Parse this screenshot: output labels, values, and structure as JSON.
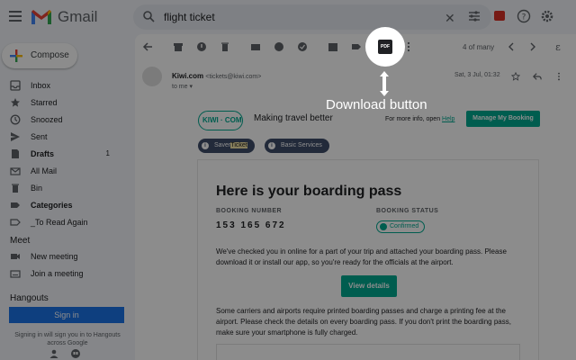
{
  "app": {
    "name": "Gmail"
  },
  "search": {
    "query": "flight ticket"
  },
  "sidebar": {
    "compose_label": "Compose",
    "items": [
      {
        "label": "Inbox",
        "count": ""
      },
      {
        "label": "Starred",
        "count": ""
      },
      {
        "label": "Snoozed",
        "count": ""
      },
      {
        "label": "Sent",
        "count": ""
      },
      {
        "label": "Drafts",
        "count": "1"
      },
      {
        "label": "All Mail",
        "count": ""
      },
      {
        "label": "Bin",
        "count": ""
      },
      {
        "label": "Categories",
        "count": ""
      },
      {
        "label": "_To Read Again",
        "count": ""
      }
    ],
    "meet_header": "Meet",
    "meet_items": [
      "New meeting",
      "Join a meeting"
    ],
    "hangouts_header": "Hangouts",
    "signin_label": "Sign in",
    "signin_text": "Signing in will sign you in to Hangouts across Google"
  },
  "toolbar": {
    "page_count": "4 of many",
    "pdf_label": "PDF"
  },
  "annotation": {
    "callout": "Download button"
  },
  "email": {
    "sender_name": "Kiwi.com",
    "sender_email": "<tickets@kiwi.com>",
    "to": "to me",
    "date": "Sat, 3 Jul, 01:32",
    "logo_text": "KIWI · COM",
    "tagline": "Making travel better",
    "more_info": "For more info, open",
    "help_link": "Help",
    "manage_btn": "Manage My Booking",
    "pill1_pre": "Saver",
    "pill1_hl": "Ticket",
    "pill2": "Basic Services",
    "heading": "Here is your boarding pass",
    "booking_number_label": "BOOKING NUMBER",
    "booking_number": "153 165 672",
    "booking_status_label": "BOOKING STATUS",
    "booking_status": "Confirmed",
    "para1": "We've checked you in online for a part of your trip and attached your boarding pass. Please download it or install our app, so you're ready for the officials at the airport.",
    "view_btn": "View details",
    "para2": "Some carriers and airports require printed boarding passes and charge a printing fee at the airport. Please check the details on every boarding pass. If you don't print the boarding pass, make sure your smartphone is fully charged."
  }
}
